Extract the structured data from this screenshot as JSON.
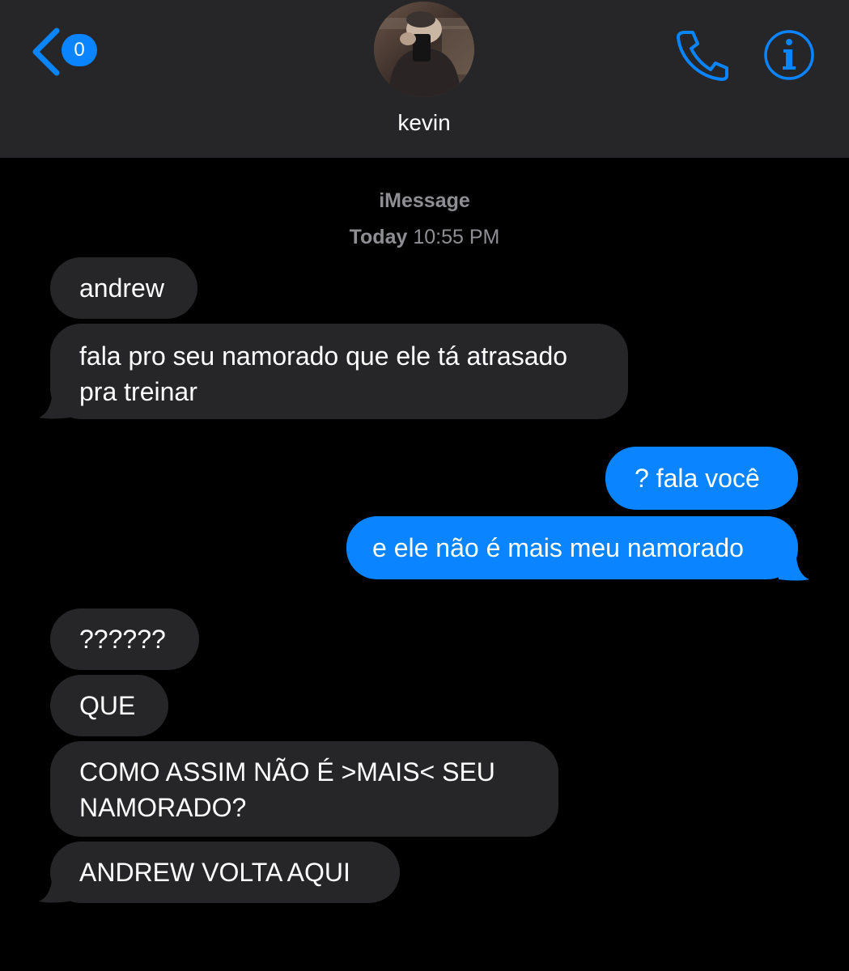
{
  "header": {
    "back_badge": "0",
    "contact_name": "kevin",
    "back_icon": "chevron-left-icon",
    "call_icon": "phone-icon",
    "info_icon": "info-icon"
  },
  "conversation": {
    "service_label": "iMessage",
    "timestamp_day": "Today",
    "timestamp_time": "10:55 PM",
    "messages": [
      {
        "direction": "incoming",
        "lines": [
          "andrew"
        ]
      },
      {
        "direction": "incoming",
        "lines": [
          "fala pro seu namorado que ele tá atrasado",
          "pra treinar"
        ]
      },
      {
        "direction": "outgoing",
        "lines": [
          "? fala você"
        ]
      },
      {
        "direction": "outgoing",
        "lines": [
          "e ele não é mais meu namorado"
        ]
      },
      {
        "direction": "incoming",
        "lines": [
          "??????"
        ]
      },
      {
        "direction": "incoming",
        "lines": [
          "QUE"
        ]
      },
      {
        "direction": "incoming",
        "lines": [
          "COMO ASSIM NÃO É >MAIS< SEU",
          "NAMORADO?"
        ]
      },
      {
        "direction": "incoming",
        "lines": [
          "ANDREW VOLTA AQUI"
        ]
      }
    ]
  },
  "colors": {
    "header_bg": "#262628",
    "accent": "#0a84ff",
    "incoming_bubble": "#262628",
    "outgoing_bubble": "#0a84ff",
    "meta_text": "#8e8e93"
  }
}
